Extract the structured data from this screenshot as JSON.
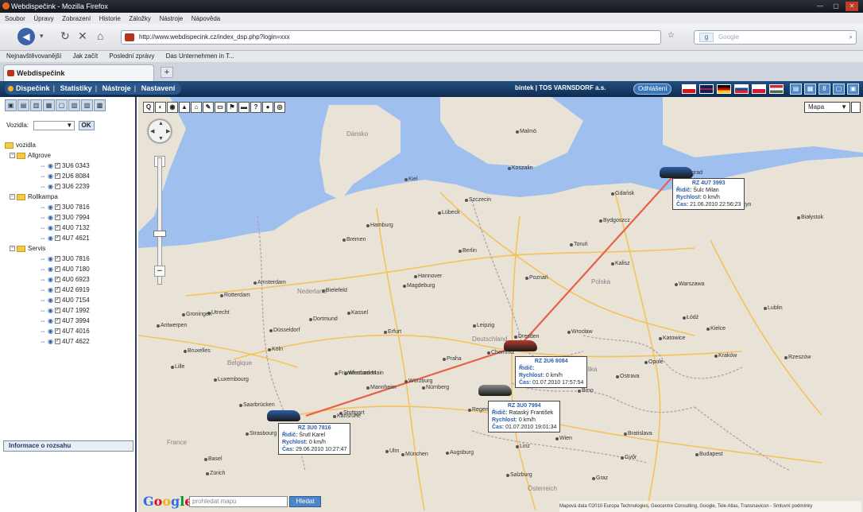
{
  "browser": {
    "window_title": "Webdispečink - Mozilla Firefox",
    "menu": [
      "Soubor",
      "Úpravy",
      "Zobrazení",
      "Historie",
      "Záložky",
      "Nástroje",
      "Nápověda"
    ],
    "url": "http://www.webdispecink.cz/index_dsp.php?login=xxx",
    "search_placeholder": "Google",
    "bookmarks": [
      "Nejnavštěvovanější",
      "Jak začít",
      "Poslední zprávy",
      "Das Unternehmen in T..."
    ],
    "tab_title": "Webdispečink",
    "new_tab": "+"
  },
  "app": {
    "nav": [
      "Dispečink",
      "Statistiky",
      "Nástroje",
      "Nastavení"
    ],
    "user": "bintek | TOS VARNSDORF a.s.",
    "logout_label": "Odhlášení",
    "flags": [
      {
        "name": "cz-flag",
        "colors": [
          "#ffffff",
          "#d7141a",
          "#11457e"
        ]
      },
      {
        "name": "uk-flag",
        "colors": [
          "#012169",
          "#c8102e",
          "#ffffff"
        ]
      },
      {
        "name": "de-flag",
        "colors": [
          "#000000",
          "#dd0000",
          "#ffce00"
        ]
      },
      {
        "name": "sk-flag",
        "colors": [
          "#ffffff",
          "#0b4ea2",
          "#ee1c25"
        ]
      },
      {
        "name": "pl-flag",
        "colors": [
          "#ffffff",
          "#dc143c",
          "#dc143c"
        ]
      },
      {
        "name": "hu-flag",
        "colors": [
          "#ce2939",
          "#ffffff",
          "#477050"
        ]
      }
    ],
    "toolbar_icons": [
      "document-icon",
      "save-icon",
      "info-icon",
      "print-icon",
      "expand-icon"
    ],
    "toolbar_glyphs": [
      "▤",
      "▦",
      "8",
      "▢",
      "▣"
    ]
  },
  "sidebar": {
    "toolbar_glyphs": [
      "▣",
      "▤",
      "▥",
      "▦",
      "▢",
      "▧",
      "▨",
      "▩"
    ],
    "filter_label": "Vozidla:",
    "filter_value": "▼",
    "ok_label": "OK",
    "root": "vozidla",
    "groups": [
      {
        "name": "Allgrove",
        "vehicles": [
          "3U6 0343",
          "2U6 8084",
          "3U6 2239"
        ]
      },
      {
        "name": "Rollkampa",
        "vehicles": [
          "3U0 7816",
          "3U0 7994",
          "4U0 7132",
          "4U7 4621"
        ]
      },
      {
        "name": "Servis",
        "vehicles": [
          "3U0 7816",
          "4U0 7180",
          "4U0 6923",
          "4U2 6919",
          "4U0 7154",
          "4U7 1992",
          "4U7 3994",
          "4U7 4016",
          "4U7 4622"
        ]
      }
    ],
    "info_label": "Informace o rozsahu"
  },
  "map": {
    "tool_glyphs": [
      "Q",
      "◐",
      "◉",
      "▲",
      "⌂",
      "✎",
      "▭",
      "⚑",
      "▬",
      "?",
      "●",
      "◎"
    ],
    "type_label": "Mapa",
    "type_arrow": "▼",
    "google_label": "Google",
    "search_placeholder": "prohledat mapu",
    "search_button": "Hledat",
    "attribution": "Mapová data ©2010 Europa Technologies, Geocentre Consulting, Google, Tele Atlas, Transnavicon - Smluvní podmínky",
    "zoom_plus": "+",
    "zoom_minus": "−",
    "countries": [
      "Dánsko",
      "Deutschland",
      "Polska",
      "Česká republika",
      "Österreich",
      "Nederland",
      "Belgique",
      "France"
    ],
    "cities": [
      "Kaliningrad",
      "Gdańsk",
      "Hamburg",
      "Bremen",
      "Berlin",
      "Poznań",
      "Warszawa",
      "Łódź",
      "Hannover",
      "Amsterdam",
      "Rotterdam",
      "Düsseldorf",
      "Köln",
      "Dortmund",
      "Frankfurt am Main",
      "Leipzig",
      "Dresden",
      "Praha",
      "Wrocław",
      "Kraków",
      "Brno",
      "Nürnberg",
      "Stuttgart",
      "München",
      "Wien",
      "Bratislava",
      "Budapest",
      "Luxembourg",
      "Strasbourg",
      "Bruxelles",
      "Lille",
      "Szczecin",
      "Bydgoszcz",
      "Lübeck",
      "Kiel",
      "Magdeburg",
      "Erfurt",
      "Chemnitz",
      "Linz",
      "Graz",
      "Katowice",
      "Ostrava",
      "Olsztyn",
      "Białystok",
      "Lublin",
      "Rzeszów",
      "Bielefeld",
      "Kassel",
      "Würzburg",
      "Regensburg",
      "Augsburg",
      "Zürich",
      "Basel",
      "Groningen",
      "Utrecht",
      "Antwerpen",
      "Malmö",
      "Koszalin",
      "Toruń",
      "Kalisz",
      "Opole",
      "Wiesbaden",
      "Mannheim",
      "Karlsruhe",
      "Saarbrücken",
      "Ulm",
      "Salzburg",
      "Győr",
      "Kielce"
    ],
    "vehicles": [
      {
        "name": "RZ 4U7 3993",
        "driver_label": "Řidič:",
        "driver": "Šulc Milan",
        "speed_label": "Rychlost:",
        "speed": "0 km/h",
        "time_label": "Čas:",
        "time": "21.06.2010 22:56:23",
        "color": "#2d5ea8"
      },
      {
        "name": "RZ 2U6 8084",
        "driver_label": "Řidič:",
        "driver": "",
        "speed_label": "Rychlost:",
        "speed": "0 km/h",
        "time_label": "Čas:",
        "time": "01.07.2010 17:57:54",
        "color": "#b33a2e"
      },
      {
        "name": "RZ 3U0 7994",
        "driver_label": "Řidič:",
        "driver": "Rataský František",
        "speed_label": "Rychlost:",
        "speed": "0 km/h",
        "time_label": "Čas:",
        "time": "01.07.2010 19:01:34",
        "color": "#8a8a8a"
      },
      {
        "name": "RZ 3U0 7816",
        "driver_label": "Řidič:",
        "driver": "Šrutl Karel",
        "speed_label": "Rychlost:",
        "speed": "0 km/h",
        "time_label": "Čas:",
        "time": "29.06.2010 10:27:47",
        "color": "#2d5ea8"
      }
    ]
  }
}
